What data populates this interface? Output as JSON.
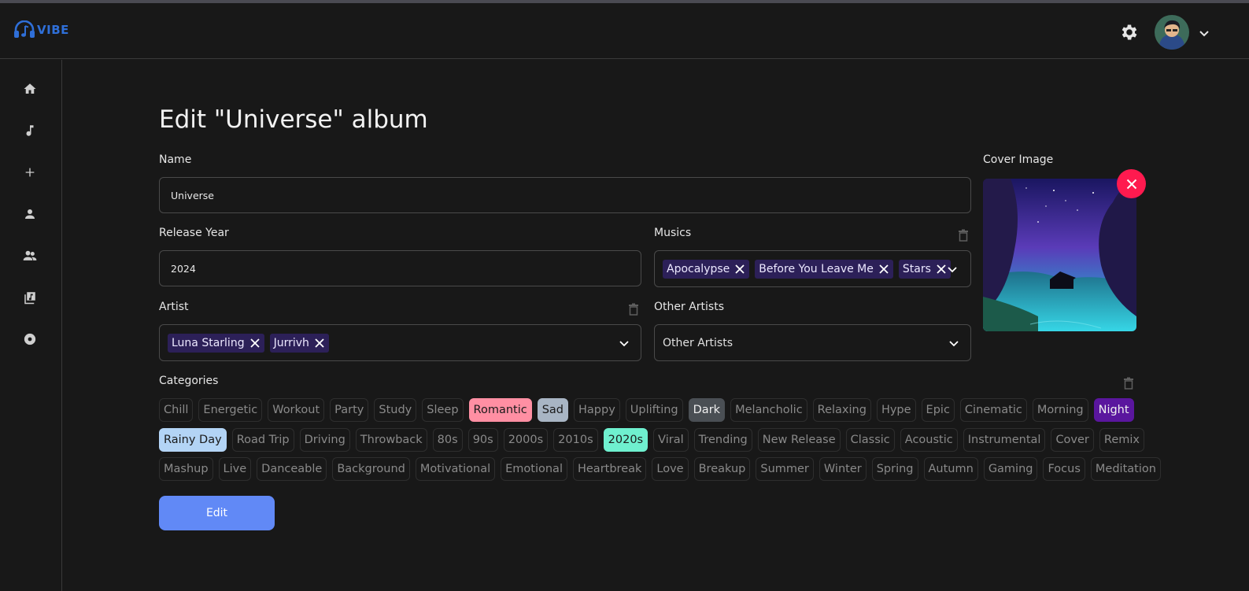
{
  "brand": {
    "name": "VIBE",
    "color": "#2f6fd8"
  },
  "header": {
    "settings_icon": "gear-icon",
    "account_menu_icon": "chevron-down-icon"
  },
  "sidebar": {
    "items": [
      {
        "icon": "home-icon"
      },
      {
        "icon": "music-note-icon"
      },
      {
        "icon": "plus-icon"
      },
      {
        "icon": "user-icon"
      },
      {
        "icon": "users-icon"
      },
      {
        "icon": "library-icon"
      },
      {
        "icon": "disc-icon"
      }
    ]
  },
  "page": {
    "title": "Edit \"Universe\" album"
  },
  "form": {
    "name": {
      "label": "Name",
      "value": "Universe"
    },
    "release_year": {
      "label": "Release Year",
      "value": "2024"
    },
    "musics": {
      "label": "Musics",
      "selected": [
        "Apocalypse",
        "Before You Leave Me",
        "Stars"
      ]
    },
    "artist": {
      "label": "Artist",
      "selected": [
        "Luna Starling",
        "Jurrivh"
      ]
    },
    "other_artists": {
      "label": "Other Artists",
      "placeholder": "Other Artists"
    },
    "cover": {
      "label": "Cover Image"
    },
    "categories": {
      "label": "Categories",
      "rows": [
        [
          {
            "name": "Chill"
          },
          {
            "name": "Energetic"
          },
          {
            "name": "Workout"
          },
          {
            "name": "Party"
          },
          {
            "name": "Study"
          },
          {
            "name": "Sleep"
          },
          {
            "name": "Romantic",
            "selected": true,
            "bg": "#ff8fa3",
            "fg": "#1a1a1a"
          },
          {
            "name": "Sad",
            "selected": true,
            "bg": "#a8b5c4",
            "fg": "#1a1a1a"
          },
          {
            "name": "Happy"
          },
          {
            "name": "Uplifting"
          },
          {
            "name": "Dark",
            "selected": true,
            "bg": "#4a4f54",
            "fg": "#f0f0f0"
          },
          {
            "name": "Melancholic"
          },
          {
            "name": "Relaxing"
          },
          {
            "name": "Hype"
          },
          {
            "name": "Epic"
          },
          {
            "name": "Cinematic"
          },
          {
            "name": "Morning"
          },
          {
            "name": "Night",
            "selected": true,
            "bg": "#5a169e",
            "fg": "#f0f0f0"
          }
        ],
        [
          {
            "name": "Rainy Day",
            "selected": true,
            "bg": "#b3d4f5",
            "fg": "#1a1a1a"
          },
          {
            "name": "Road Trip"
          },
          {
            "name": "Driving"
          },
          {
            "name": "Throwback"
          },
          {
            "name": "80s"
          },
          {
            "name": "90s"
          },
          {
            "name": "2000s"
          },
          {
            "name": "2010s"
          },
          {
            "name": "2020s",
            "selected": true,
            "bg": "#6ff0cf",
            "fg": "#1a1a1a"
          },
          {
            "name": "Viral"
          },
          {
            "name": "Trending"
          },
          {
            "name": "New Release"
          },
          {
            "name": "Classic"
          },
          {
            "name": "Acoustic"
          },
          {
            "name": "Instrumental"
          },
          {
            "name": "Cover"
          },
          {
            "name": "Remix"
          }
        ],
        [
          {
            "name": "Mashup"
          },
          {
            "name": "Live"
          },
          {
            "name": "Danceable"
          },
          {
            "name": "Background"
          },
          {
            "name": "Motivational"
          },
          {
            "name": "Emotional"
          },
          {
            "name": "Heartbreak"
          },
          {
            "name": "Love"
          },
          {
            "name": "Breakup"
          },
          {
            "name": "Summer"
          },
          {
            "name": "Winter"
          },
          {
            "name": "Spring"
          },
          {
            "name": "Autumn"
          },
          {
            "name": "Gaming"
          },
          {
            "name": "Focus"
          },
          {
            "name": "Meditation"
          }
        ]
      ]
    },
    "submit_label": "Edit"
  },
  "colors": {
    "accent": "#6189f6",
    "chip_bg": "#2c2058",
    "danger": "#ff1a4f",
    "background": "#181818"
  }
}
